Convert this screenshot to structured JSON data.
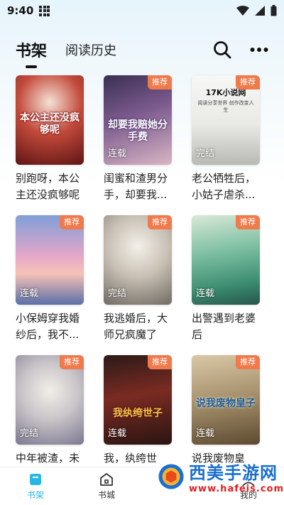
{
  "status_bar": {
    "time": "9:40"
  },
  "header": {
    "tabs": [
      {
        "label": "书架",
        "active": true
      },
      {
        "label": "阅读历史",
        "active": false
      }
    ],
    "icons": [
      "search-icon",
      "more-icon"
    ]
  },
  "books": [
    {
      "title": "别跑呀，本公主还没疯够呢",
      "status": "",
      "badge": "",
      "cover_text": "本公主还没疯够呢"
    },
    {
      "title": "闺蜜和渣男分手，却要我...",
      "status": "连载",
      "badge": "推荐",
      "cover_text": "却要我赔她分手费"
    },
    {
      "title": "老公牺牲后，小姑子虐杀...",
      "status": "完结",
      "badge": "推荐",
      "cover_brand": "17K小说网",
      "cover_brand_sub": "阅读分享世界 创作改变人生"
    },
    {
      "title": "小保姆穿我婚纱后，我不...",
      "status": "连载",
      "badge": "推荐"
    },
    {
      "title": "我逃婚后，大师兄疯魔了",
      "status": "完结",
      "badge": "推荐"
    },
    {
      "title": "出警遇到老婆后",
      "status": "连载",
      "badge": "推荐"
    },
    {
      "title": "中年被渣，未",
      "status": "完结",
      "badge": "推荐"
    },
    {
      "title": "我，纨绔世",
      "status": "连载",
      "badge": "推荐",
      "cover_text": "我纨绔世子"
    },
    {
      "title": "说我废物皇",
      "status": "连载",
      "badge": "推荐",
      "cover_text": "说我废物皇子"
    }
  ],
  "bottom_nav": [
    {
      "label": "书架",
      "active": true
    },
    {
      "label": "书城",
      "active": false
    },
    {
      "label": "我的",
      "active": false
    }
  ],
  "watermark": {
    "main": "西美手游网",
    "url": "www.hafeis.com"
  },
  "colors": {
    "accent": "#28b7e3",
    "badge": "#ef7a4c"
  }
}
